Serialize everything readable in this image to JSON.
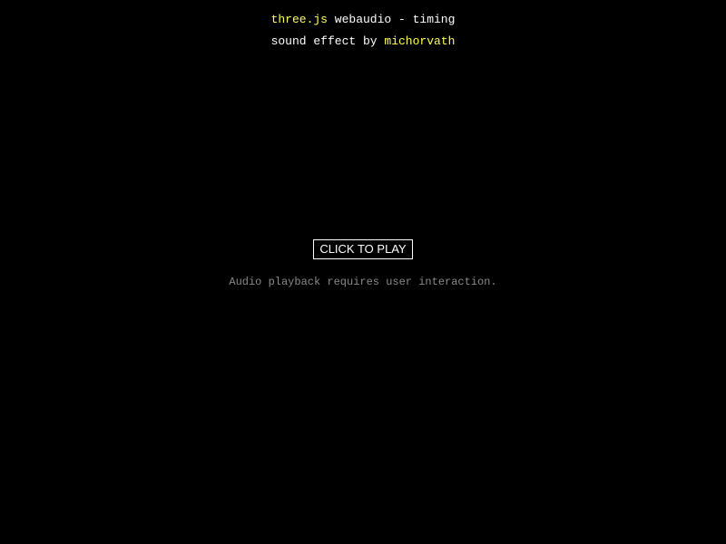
{
  "info": {
    "line1": {
      "link_text": "three.js",
      "rest_text": " webaudio - timing"
    },
    "line2": {
      "prefix_text": "sound effect by ",
      "link_text": "michorvath"
    }
  },
  "overlay": {
    "button_label": "CLICK TO PLAY",
    "note_text": "Audio playback requires user interaction."
  },
  "colors": {
    "background": "#000000",
    "text": "#ffffff",
    "link": "#ffff55",
    "note": "#8a8a8a"
  }
}
